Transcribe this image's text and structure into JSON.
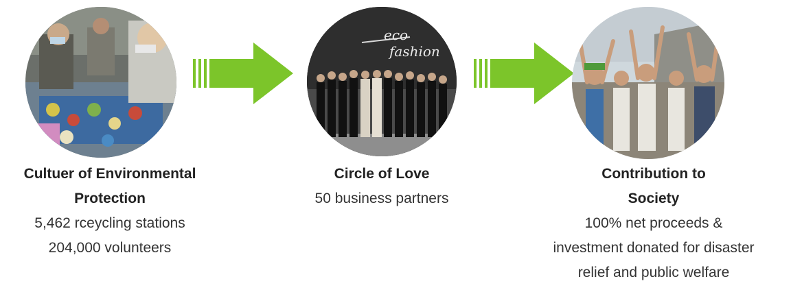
{
  "steps": [
    {
      "title_lines": [
        "Cultuer of Environmental",
        "Protection"
      ],
      "detail_lines": [
        "5,462 rceycling stations",
        "204,000 volunteers"
      ],
      "image": "recycling-volunteers-photo"
    },
    {
      "title_lines": [
        "Circle of Love"
      ],
      "detail_lines": [
        "50 business partners"
      ],
      "image": "eco-fashion-group-photo",
      "image_text": [
        "eco",
        "fashion"
      ]
    },
    {
      "title_lines": [
        "Contribution to",
        "Society"
      ],
      "detail_lines": [
        "100% net proceeds &",
        "investment donated for disaster",
        "relief and public welfare"
      ],
      "image": "cheering-community-photo"
    }
  ],
  "arrows": [
    "arrow-right-icon",
    "arrow-right-icon"
  ],
  "colors": {
    "arrow_green": "#7cc52a",
    "arrow_green_dark": "#5fa81c",
    "title_text": "#222222",
    "body_text": "#333333"
  }
}
